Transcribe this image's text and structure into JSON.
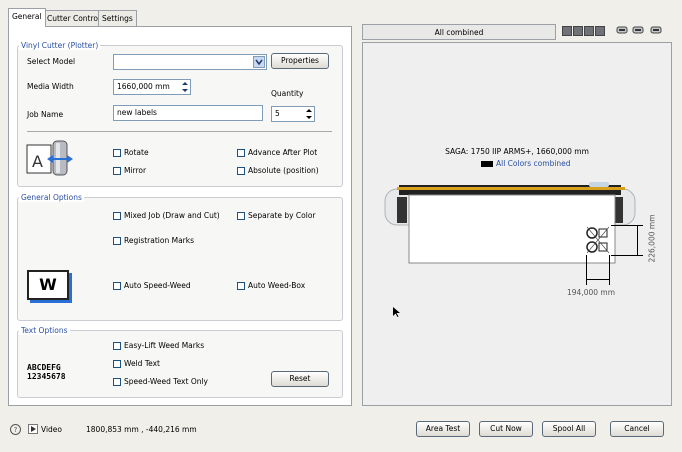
{
  "tabs": [
    "General",
    "Cutter Control",
    "Settings"
  ],
  "vinyl": {
    "legend": "Vinyl Cutter (Plotter)",
    "select_model_label": "Select Model",
    "select_model_value": "",
    "properties_button": "Properties",
    "media_width_label": "Media Width",
    "media_width_value": "1660,000 mm",
    "quantity_label": "Quantity",
    "quantity_value": "5",
    "job_name_label": "Job Name",
    "job_name_value": "new labels",
    "rotate": "Rotate",
    "mirror": "Mirror",
    "advance": "Advance After Plot",
    "absolute": "Absolute (position)"
  },
  "general": {
    "legend": "General Options",
    "mixed_job": "Mixed Job (Draw and Cut)",
    "separate": "Separate by Color",
    "registration": "Registration Marks",
    "speed_weed": "Auto Speed-Weed",
    "weed_box": "Auto Weed-Box",
    "icon_letter": "W"
  },
  "text": {
    "legend": "Text Options",
    "easy_lift": "Easy-Lift Weed Marks",
    "weld": "Weld Text",
    "speed_text": "Speed-Weed Text Only",
    "reset_button": "Reset",
    "sample_1": "ABCDEFG",
    "sample_2": "12345678"
  },
  "preview": {
    "header": "All combined",
    "plotter_name": "SAGA: 1750 IIP ARMS+,  1660,000 mm",
    "legend_label": "All Colors combined",
    "dim_height": "226,000 mm",
    "dim_width": "194,000 mm"
  },
  "status": {
    "video_label": "Video",
    "coordinates": "1800,853 mm ,  -440,216 mm",
    "area_test": "Area Test",
    "cut_now": "Cut Now",
    "spool_all": "Spool All",
    "cancel": "Cancel"
  },
  "colors": {
    "accent": "#2a4fa3",
    "window_bg": "#f0efe9",
    "panel_border": "#9aa0a6"
  }
}
